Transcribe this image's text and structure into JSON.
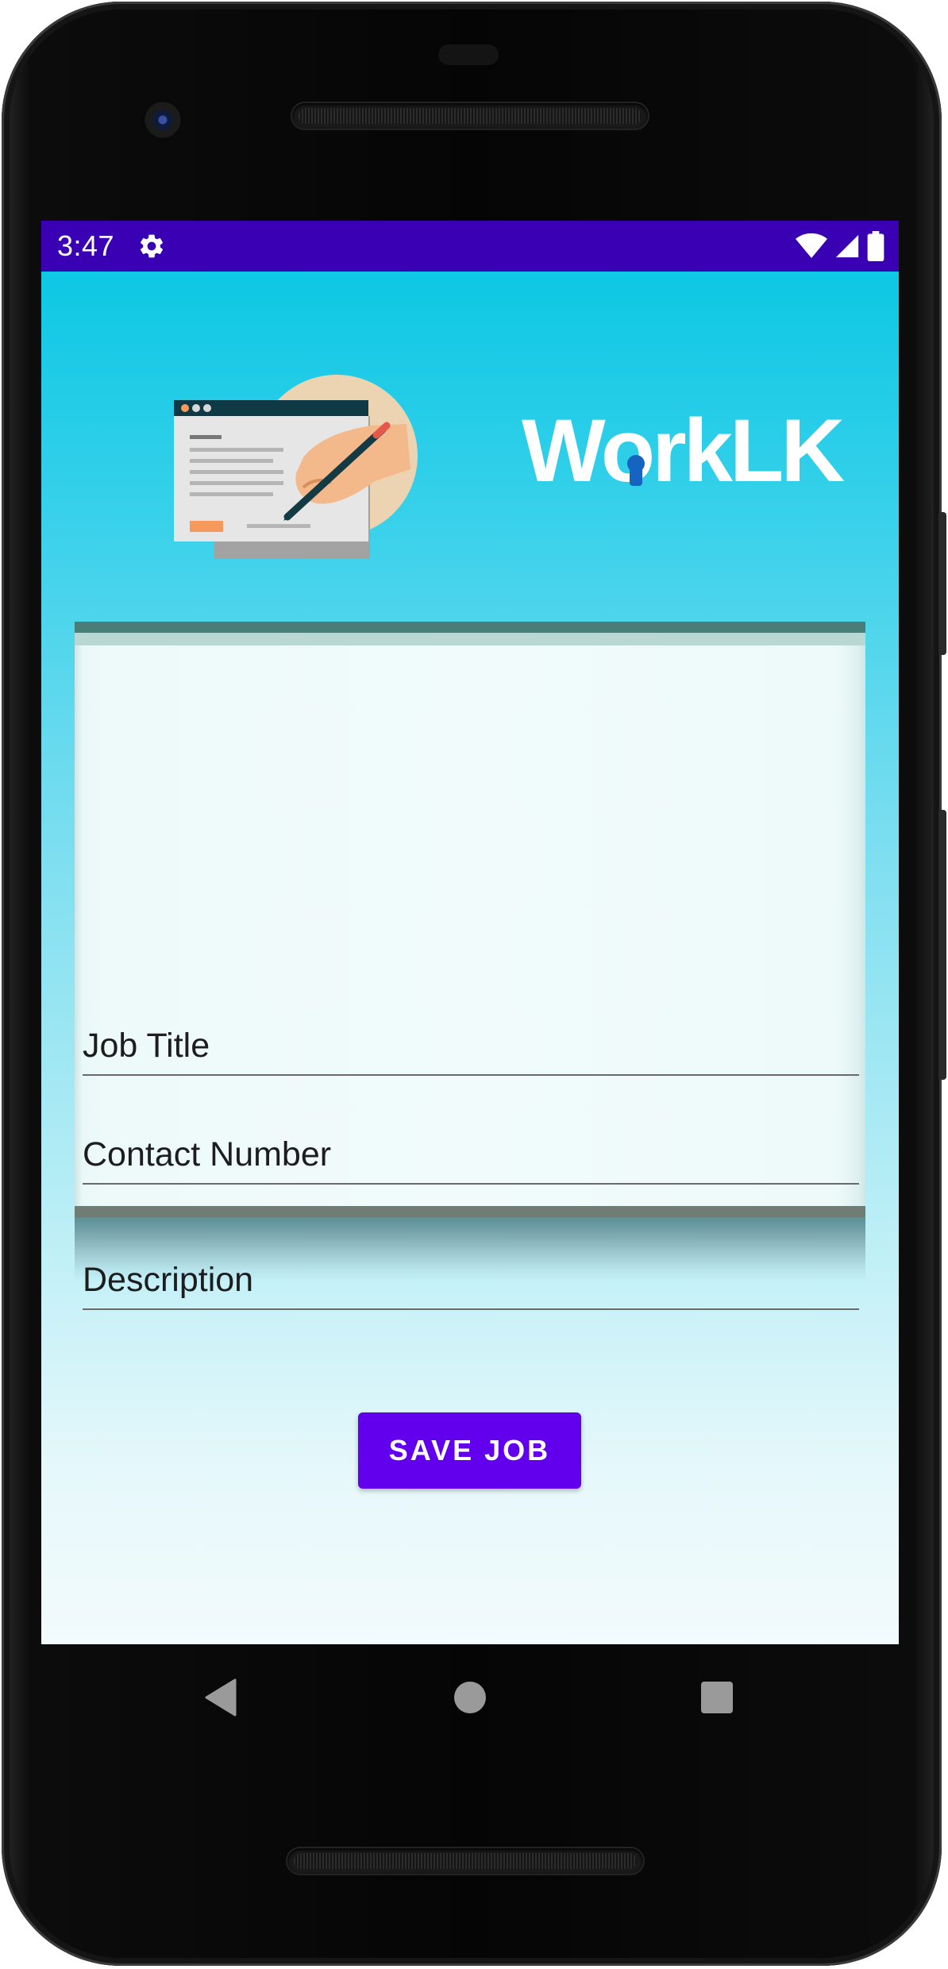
{
  "status_bar": {
    "time": "3:47",
    "icons": [
      "settings-icon",
      "wifi-icon",
      "cellular-signal-icon",
      "battery-icon"
    ],
    "background_color": "#3a00b4"
  },
  "header": {
    "illustration": "document-editing-illustration",
    "logo_text": "WorkLK",
    "logo_accent_color": "#1565c0"
  },
  "form": {
    "fields": [
      {
        "label": "Job Title"
      },
      {
        "label": "Contact Number"
      },
      {
        "label": "Description"
      }
    ]
  },
  "actions": {
    "save_label": "SAVE JOB",
    "save_color": "#6200ee"
  },
  "nav_bar": {
    "buttons": [
      "back-icon",
      "home-icon",
      "recents-icon"
    ]
  },
  "colors": {
    "gradient_top": "#04c6e2",
    "gradient_bottom": "#f2fbfd"
  }
}
